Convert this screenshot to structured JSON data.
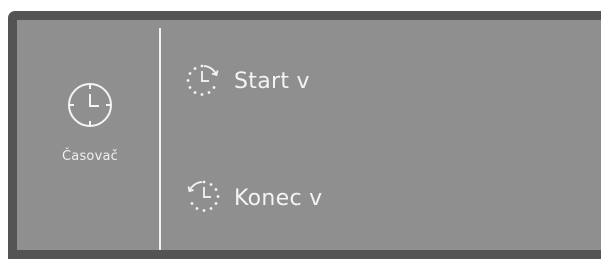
{
  "sidebar": {
    "icon": "clock-icon",
    "label": "Časovač"
  },
  "menu": {
    "items": [
      {
        "icon": "clock-start-icon",
        "label": "Start v"
      },
      {
        "icon": "clock-end-icon",
        "label": "Konec v"
      }
    ]
  },
  "colors": {
    "panel_border": "#545455",
    "screen_bg": "#8f8f90",
    "text": "#f4f4f4"
  }
}
